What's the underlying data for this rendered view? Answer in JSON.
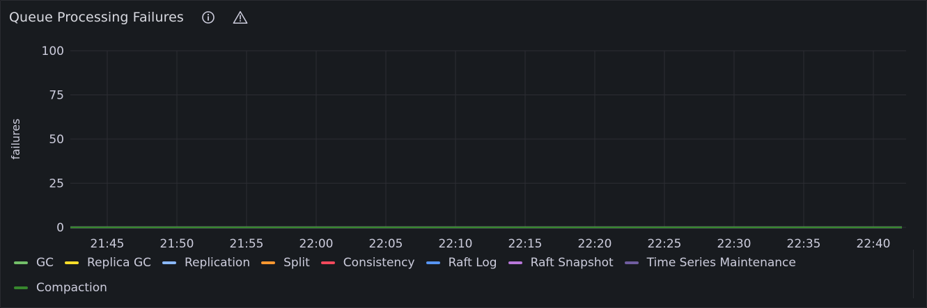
{
  "panel": {
    "title": "Queue Processing Failures",
    "info_icon": "info-icon",
    "warning_icon": "warning-icon"
  },
  "chart_data": {
    "type": "line",
    "title": "Queue Processing Failures",
    "xlabel": "",
    "ylabel": "failures",
    "ylim": [
      0,
      100
    ],
    "yticks": [
      "0",
      "25",
      "50",
      "75",
      "100"
    ],
    "x": [
      "21:45",
      "21:50",
      "21:55",
      "22:00",
      "22:05",
      "22:10",
      "22:15",
      "22:20",
      "22:25",
      "22:30",
      "22:35",
      "22:40"
    ],
    "grid": true,
    "legend_position": "bottom",
    "series": [
      {
        "name": "GC",
        "color": "#73bf69",
        "values": [
          0,
          0,
          0,
          0,
          0,
          0,
          0,
          0,
          0,
          0,
          0,
          0
        ]
      },
      {
        "name": "Replica GC",
        "color": "#fade2a",
        "values": [
          0,
          0,
          0,
          0,
          0,
          0,
          0,
          0,
          0,
          0,
          0,
          0
        ]
      },
      {
        "name": "Replication",
        "color": "#8ab8ff",
        "values": [
          0,
          0,
          0,
          0,
          0,
          0,
          0,
          0,
          0,
          0,
          0,
          0
        ]
      },
      {
        "name": "Split",
        "color": "#ff9830",
        "values": [
          0,
          0,
          0,
          0,
          0,
          0,
          0,
          0,
          0,
          0,
          0,
          0
        ]
      },
      {
        "name": "Consistency",
        "color": "#f2495c",
        "values": [
          0,
          0,
          0,
          0,
          0,
          0,
          0,
          0,
          0,
          0,
          0,
          0
        ]
      },
      {
        "name": "Raft Log",
        "color": "#5794f2",
        "values": [
          0,
          0,
          0,
          0,
          0,
          0,
          0,
          0,
          0,
          0,
          0,
          0
        ]
      },
      {
        "name": "Raft Snapshot",
        "color": "#b877d9",
        "values": [
          0,
          0,
          0,
          0,
          0,
          0,
          0,
          0,
          0,
          0,
          0,
          0
        ]
      },
      {
        "name": "Time Series Maintenance",
        "color": "#705da0",
        "values": [
          0,
          0,
          0,
          0,
          0,
          0,
          0,
          0,
          0,
          0,
          0,
          0
        ]
      },
      {
        "name": "Compaction",
        "color": "#37872d",
        "values": [
          0,
          0,
          0,
          0,
          0,
          0,
          0,
          0,
          0,
          0,
          0,
          0
        ]
      }
    ]
  }
}
